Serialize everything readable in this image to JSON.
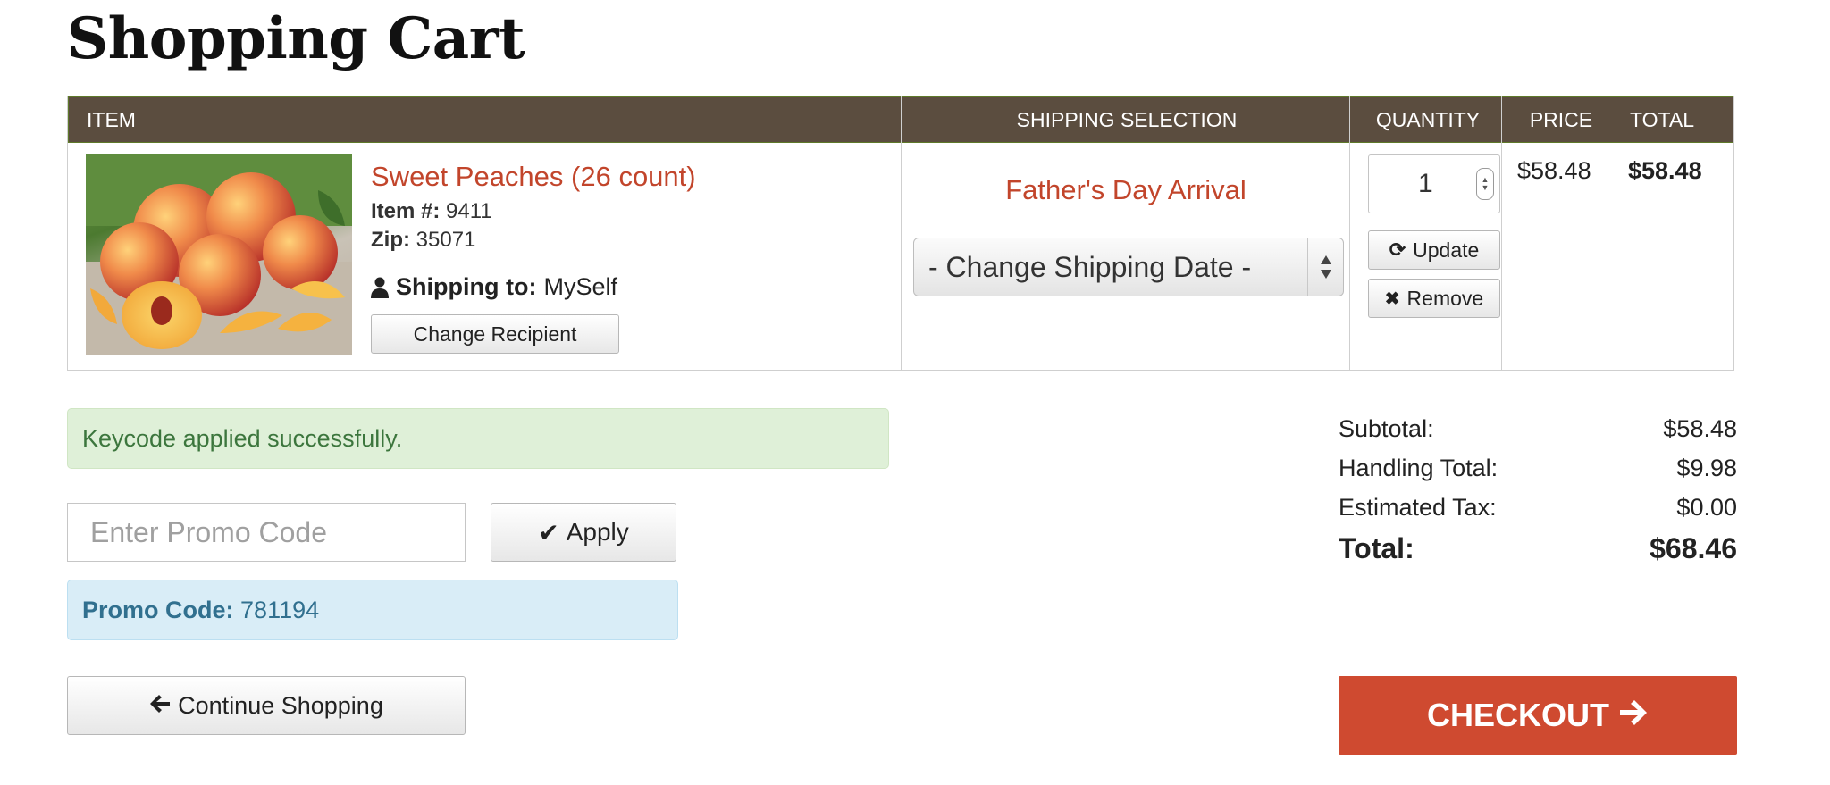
{
  "page": {
    "title": "Shopping Cart"
  },
  "table": {
    "headers": {
      "item": "ITEM",
      "shipping": "SHIPPING SELECTION",
      "quantity": "QUANTITY",
      "price": "PRICE",
      "total": "TOTAL"
    }
  },
  "item": {
    "name": "Sweet Peaches (26 count)",
    "item_label": "Item #:",
    "item_number": "9411",
    "zip_label": "Zip:",
    "zip": "35071",
    "shipping_to_label": "Shipping to:",
    "recipient": "MySelf",
    "change_recipient_label": "Change Recipient",
    "image_icon": "peaches-photo",
    "arrival": "Father's Day Arrival",
    "shipping_select_value": "- Change Shipping Date -",
    "quantity": "1",
    "update_label": "Update",
    "remove_label": "Remove",
    "price": "$58.48",
    "total": "$58.48"
  },
  "alerts": {
    "success": "Keycode applied successfully.",
    "promo_label": "Promo Code:",
    "promo_value": "781194"
  },
  "promo": {
    "placeholder": "Enter Promo Code",
    "apply_label": "Apply"
  },
  "continue_label": "Continue Shopping",
  "totals": {
    "subtotal_label": "Subtotal:",
    "subtotal": "$58.48",
    "handling_label": "Handling Total:",
    "handling": "$9.98",
    "tax_label": "Estimated Tax:",
    "tax": "$0.00",
    "total_label": "Total:",
    "total": "$68.46"
  },
  "checkout_label": "CHECKOUT",
  "colors": {
    "header_bg": "#5b4d3f",
    "accent": "#c2452b",
    "checkout": "#cf4a30",
    "success_bg": "#dff0d8",
    "info_bg": "#d9edf7"
  }
}
